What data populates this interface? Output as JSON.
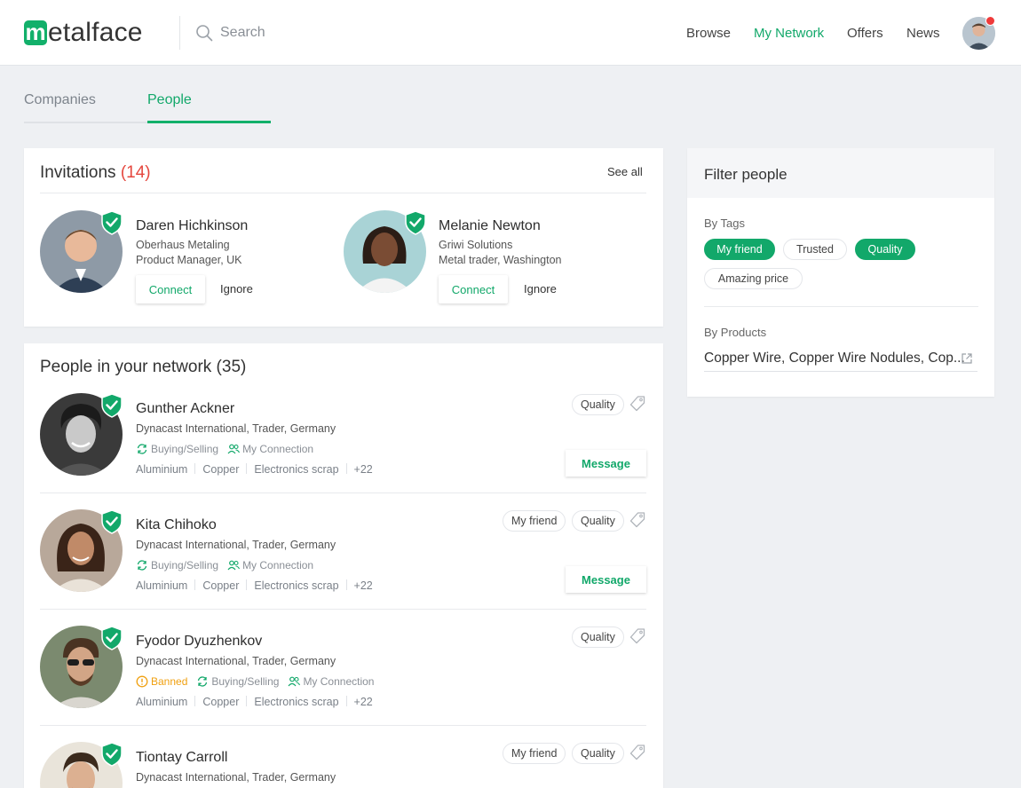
{
  "header": {
    "logo_letter": "m",
    "logo_rest": "etalface",
    "search_placeholder": "Search",
    "nav": [
      "Browse",
      "My Network",
      "Offers",
      "News"
    ],
    "active_nav": "My Network",
    "accent_color": "#12b06a",
    "notification_color": "#ef3a3a"
  },
  "tabs": {
    "companies": "Companies",
    "people": "People",
    "active": "People"
  },
  "invitations": {
    "title": "Invitations",
    "count": "(14)",
    "see_all": "See all",
    "items": [
      {
        "name": "Daren Hichkinson",
        "company": "Oberhaus Metaling",
        "role": "Product Manager, UK",
        "connect": "Connect",
        "ignore": "Ignore"
      },
      {
        "name": "Melanie Newton",
        "company": "Griwi Solutions",
        "role": "Metal trader, Washington",
        "connect": "Connect",
        "ignore": "Ignore"
      }
    ]
  },
  "network": {
    "title": "People in your network (35)",
    "message_label": "Message",
    "people": [
      {
        "name": "Gunther Ackner",
        "info": "Dynacast International, Trader, Germany",
        "statuses": [
          "Buying/Selling",
          "My Connection"
        ],
        "products": [
          "Aluminium",
          "Copper",
          "Electronics scrap",
          "+22"
        ],
        "tags": [
          "Quality"
        ]
      },
      {
        "name": "Kita Chihoko",
        "info": "Dynacast International, Trader, Germany",
        "statuses": [
          "Buying/Selling",
          "My Connection"
        ],
        "products": [
          "Aluminium",
          "Copper",
          "Electronics scrap",
          "+22"
        ],
        "tags": [
          "My friend",
          "Quality"
        ]
      },
      {
        "name": "Fyodor Dyuzhenkov",
        "info": "Dynacast International, Trader, Germany",
        "banned": "Banned",
        "statuses": [
          "Buying/Selling",
          "My Connection"
        ],
        "products": [
          "Aluminium",
          "Copper",
          "Electronics scrap",
          "+22"
        ],
        "tags": [
          "Quality"
        ]
      },
      {
        "name": "Tiontay Carroll",
        "info": "Dynacast International, Trader, Germany",
        "tags": [
          "My friend",
          "Quality"
        ]
      }
    ]
  },
  "filter": {
    "title": "Filter people",
    "by_tags": "By Tags",
    "tags": [
      {
        "label": "My friend",
        "selected": true
      },
      {
        "label": "Trusted",
        "selected": false
      },
      {
        "label": "Quality",
        "selected": true
      },
      {
        "label": "Amazing price",
        "selected": false
      }
    ],
    "by_products": "By Products",
    "products_value": "Copper Wire, Copper Wire Nodules, Cop..."
  }
}
